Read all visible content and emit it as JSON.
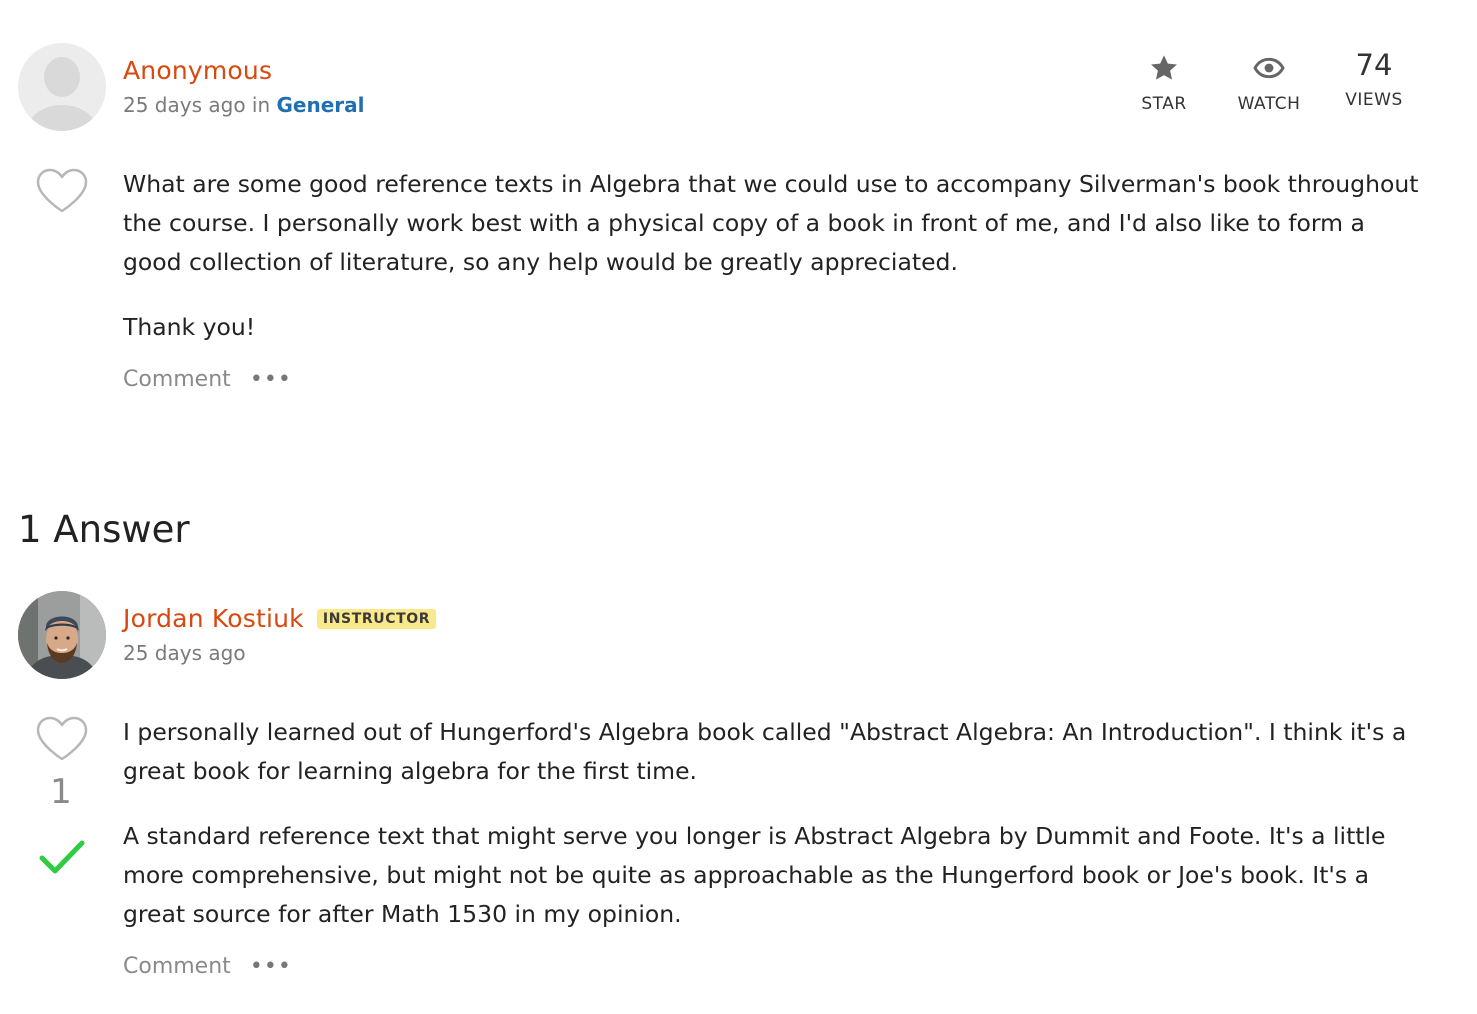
{
  "question": {
    "author": "Anonymous",
    "time": "25 days ago",
    "in_word": "in",
    "category": "General",
    "stats": {
      "star_label": "STAR",
      "watch_label": "WATCH",
      "views_count": "74",
      "views_label": "VIEWS"
    },
    "paragraphs": [
      "What are some good reference texts in Algebra that we could use to accompany Silverman's book throughout the course.  I personally work best with a physical copy of a book in front of me, and I'd also like to form a good collection of literature, so any help would be greatly appreciated.",
      "Thank you!"
    ],
    "comment_label": "Comment",
    "more_label": "•••"
  },
  "answers_heading": "1 Answer",
  "answer": {
    "author": "Jordan Kostiuk",
    "badge": "INSTRUCTOR",
    "time": "25 days ago",
    "vote_count": "1",
    "paragraphs": [
      "I personally learned out of Hungerford's Algebra book called \"Abstract Algebra: An Introduction\". I think it's a great book for learning algebra for the first time.",
      "A standard reference text that might serve you longer is Abstract Algebra by Dummit and Foote. It's a little more comprehensive, but might not be quite as approachable as the Hungerford book or Joe's book. It's a great source for after Math 1530 in my opinion."
    ],
    "comment_label": "Comment",
    "more_label": "•••"
  },
  "colors": {
    "author": "#d9480f",
    "category_link": "#1f6fb2",
    "badge_bg": "#f9e98a",
    "accepted_check": "#2ecc40"
  },
  "icons": [
    "default-avatar-icon",
    "star-icon",
    "eye-icon",
    "heart-icon",
    "checkmark-icon",
    "user-photo-avatar"
  ]
}
